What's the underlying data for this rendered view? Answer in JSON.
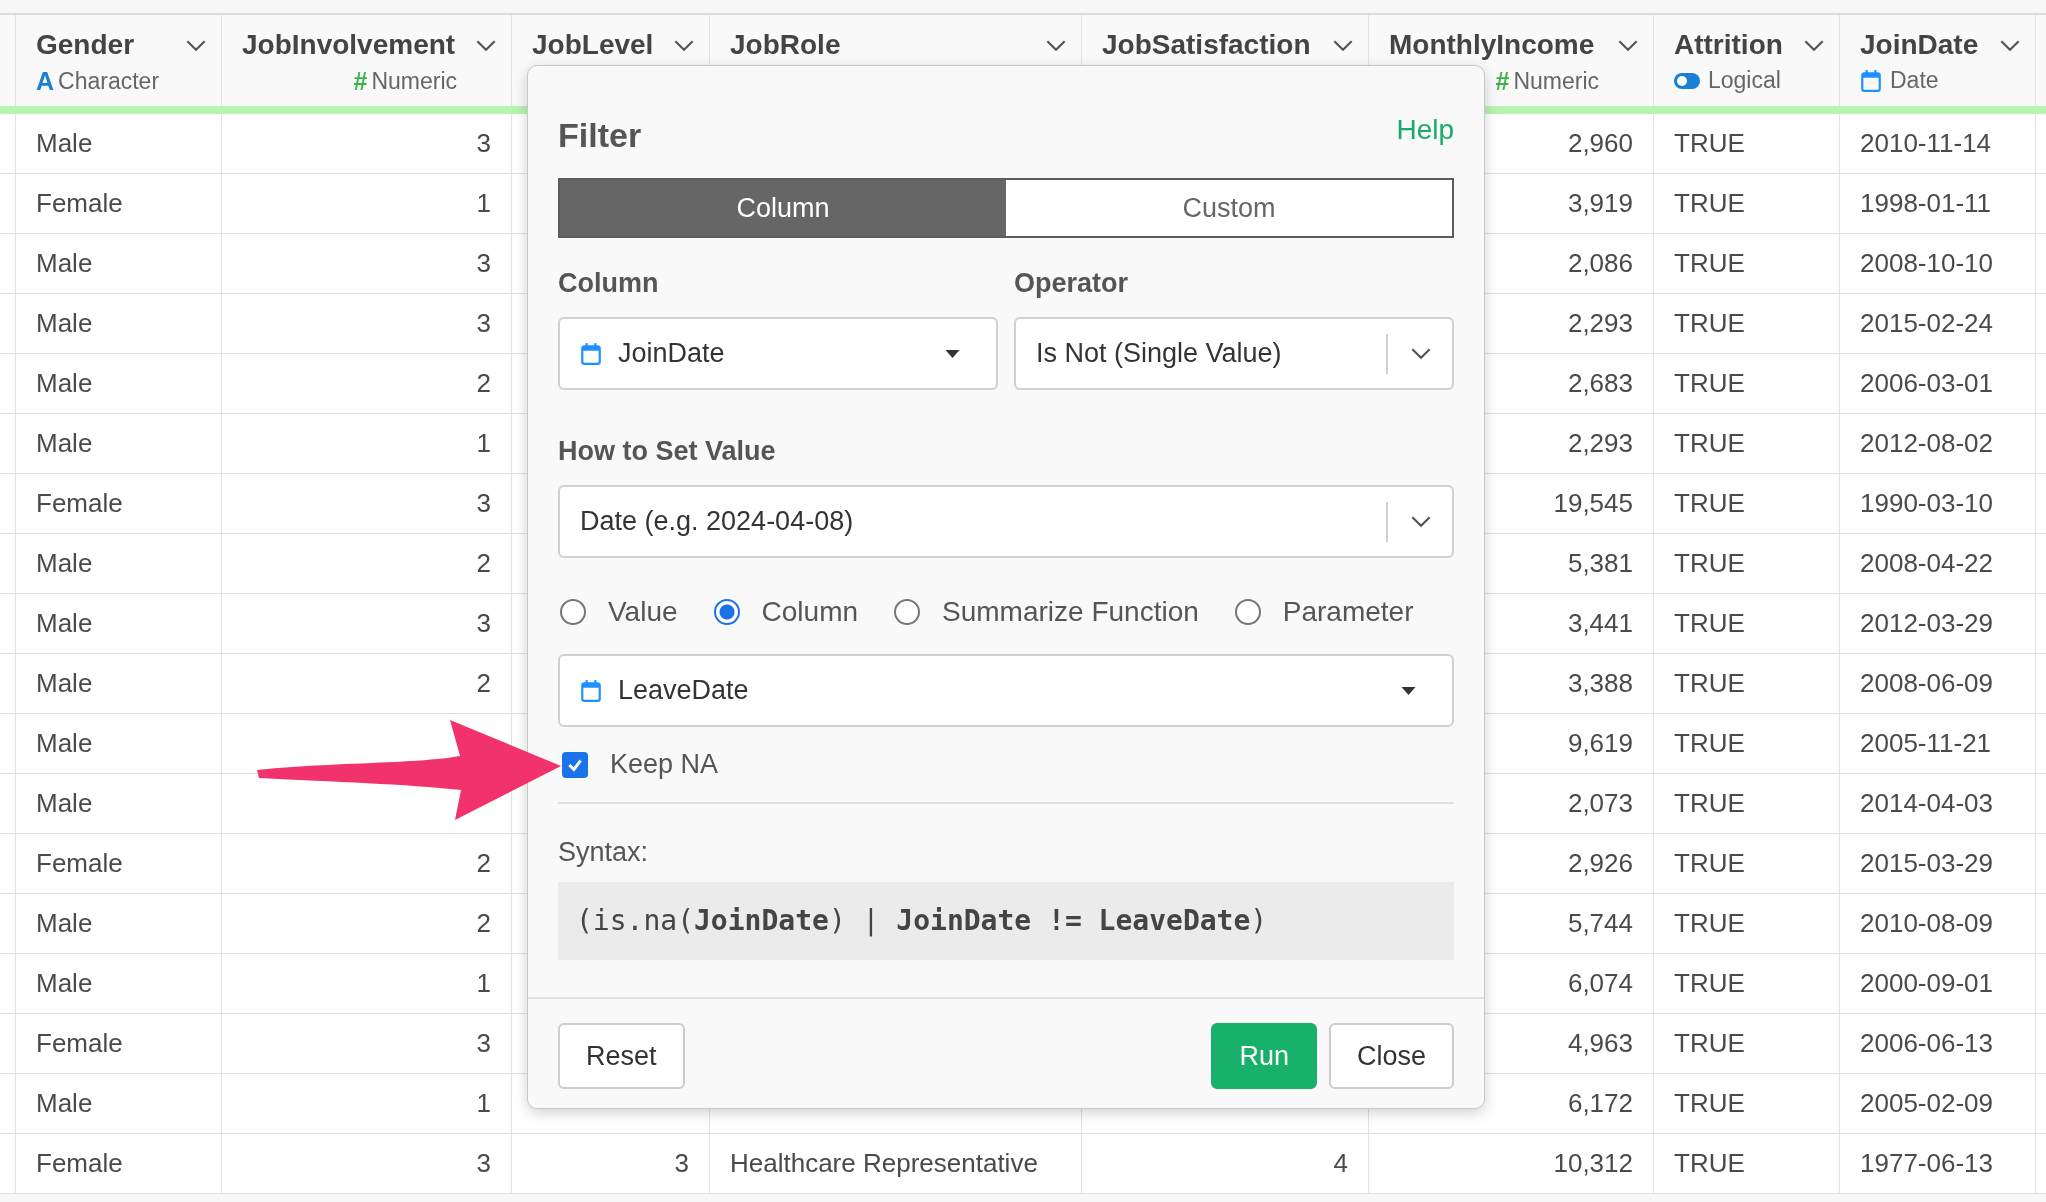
{
  "table": {
    "columns": [
      {
        "name": "Gender",
        "kind": "character",
        "type_glyph": "A",
        "type_label": "Character"
      },
      {
        "name": "JobInvolvement",
        "kind": "numeric",
        "type_glyph": "#",
        "type_label": "Numeric"
      },
      {
        "name": "JobLevel"
      },
      {
        "name": "JobRole"
      },
      {
        "name": "JobSatisfaction"
      },
      {
        "name": "MonthlyIncome",
        "kind": "numeric",
        "type_glyph": "#",
        "type_label": "Numeric"
      },
      {
        "name": "Attrition",
        "kind": "logical",
        "type_label": "Logical"
      },
      {
        "name": "JoinDate",
        "kind": "date",
        "type_label": "Date"
      }
    ],
    "rows": [
      {
        "cells": [
          "Male",
          "3",
          null,
          null,
          null,
          "2,960",
          "TRUE",
          "2010-11-14"
        ]
      },
      {
        "cells": [
          "Female",
          "1",
          null,
          null,
          null,
          "3,919",
          "TRUE",
          "1998-01-11"
        ]
      },
      {
        "cells": [
          "Male",
          "3",
          null,
          null,
          null,
          "2,086",
          "TRUE",
          "2008-10-10"
        ]
      },
      {
        "cells": [
          "Male",
          "3",
          null,
          null,
          null,
          "2,293",
          "TRUE",
          "2015-02-24"
        ]
      },
      {
        "cells": [
          "Male",
          "2",
          null,
          null,
          null,
          "2,683",
          "TRUE",
          "2006-03-01"
        ]
      },
      {
        "cells": [
          "Male",
          "1",
          null,
          null,
          null,
          "2,293",
          "TRUE",
          "2012-08-02"
        ]
      },
      {
        "cells": [
          "Female",
          "3",
          null,
          null,
          null,
          "19,545",
          "TRUE",
          "1990-03-10"
        ]
      },
      {
        "cells": [
          "Male",
          "2",
          null,
          null,
          null,
          "5,381",
          "TRUE",
          "2008-04-22"
        ]
      },
      {
        "cells": [
          "Male",
          "3",
          null,
          null,
          null,
          "3,441",
          "TRUE",
          "2012-03-29"
        ]
      },
      {
        "cells": [
          "Male",
          "2",
          null,
          null,
          null,
          "3,388",
          "TRUE",
          "2008-06-09"
        ]
      },
      {
        "cells": [
          "Male",
          null,
          null,
          null,
          null,
          "9,619",
          "TRUE",
          "2005-11-21"
        ]
      },
      {
        "cells": [
          "Male",
          null,
          null,
          null,
          null,
          "2,073",
          "TRUE",
          "2014-04-03"
        ]
      },
      {
        "cells": [
          "Female",
          "2",
          null,
          null,
          null,
          "2,926",
          "TRUE",
          "2015-03-29"
        ]
      },
      {
        "cells": [
          "Male",
          "2",
          null,
          null,
          null,
          "5,744",
          "TRUE",
          "2010-08-09"
        ]
      },
      {
        "cells": [
          "Male",
          "1",
          null,
          null,
          null,
          "6,074",
          "TRUE",
          "2000-09-01"
        ]
      },
      {
        "cells": [
          "Female",
          "3",
          null,
          null,
          null,
          "4,963",
          "TRUE",
          "2006-06-13"
        ]
      },
      {
        "cells": [
          "Male",
          "1",
          null,
          null,
          null,
          "6,172",
          "TRUE",
          "2005-02-09"
        ]
      },
      {
        "cells": [
          "Female",
          "3",
          "3",
          "Healthcare Representative",
          "4",
          "10,312",
          "TRUE",
          "1977-06-13"
        ]
      }
    ]
  },
  "filter_dialog": {
    "title": "Filter",
    "help_link": "Help",
    "tabs": [
      {
        "label": "Column",
        "selected": true
      },
      {
        "label": "Custom",
        "selected": false
      }
    ],
    "column_field": {
      "label": "Column",
      "value": "JoinDate"
    },
    "operator_field": {
      "label": "Operator",
      "value": "Is Not (Single Value)"
    },
    "set_value_field": {
      "label": "How to Set Value",
      "value": "Date (e.g. 2024-04-08)"
    },
    "value_sources": [
      {
        "label": "Value",
        "selected": false
      },
      {
        "label": "Column",
        "selected": true
      },
      {
        "label": "Summarize Function",
        "selected": false
      },
      {
        "label": "Parameter",
        "selected": false
      }
    ],
    "source_field": {
      "value": "LeaveDate"
    },
    "keep_na": {
      "label": "Keep NA",
      "checked": true
    },
    "syntax": {
      "label": "Syntax:",
      "code": "(is.na(**JoinDate**) | **JoinDate != LeaveDate**)"
    },
    "buttons": [
      {
        "label": "Reset",
        "kind": "secondary"
      },
      {
        "label": "Run",
        "kind": "primary"
      },
      {
        "label": "Close",
        "kind": "secondary"
      }
    ]
  }
}
